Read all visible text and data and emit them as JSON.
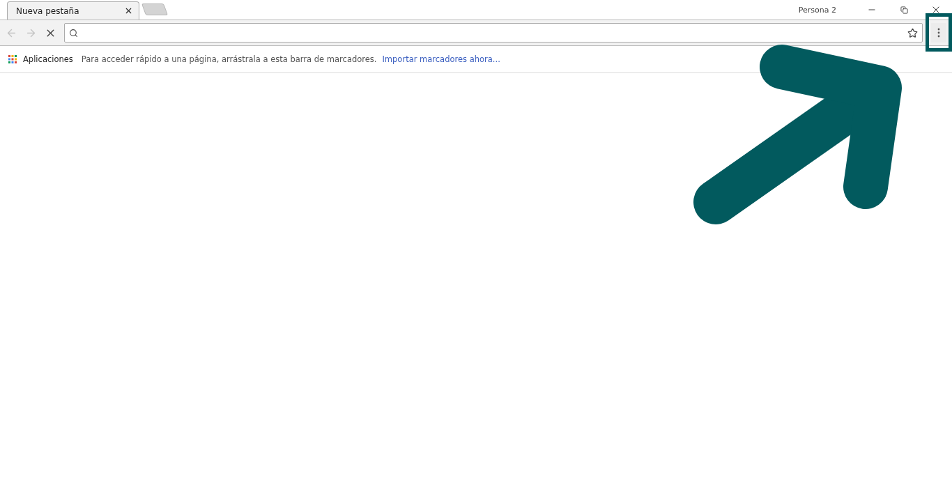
{
  "tabs": [
    {
      "title": "Nueva pestaña",
      "selected": true
    }
  ],
  "profile": "Persona 2",
  "bookmarks_bar": {
    "apps_label": "Aplicaciones",
    "hint": "Para acceder rápido a una página, arrástrala a esta barra de marcadores.",
    "link": "Importar marcadores ahora..."
  },
  "annotation": {
    "color": "#025a5e"
  }
}
